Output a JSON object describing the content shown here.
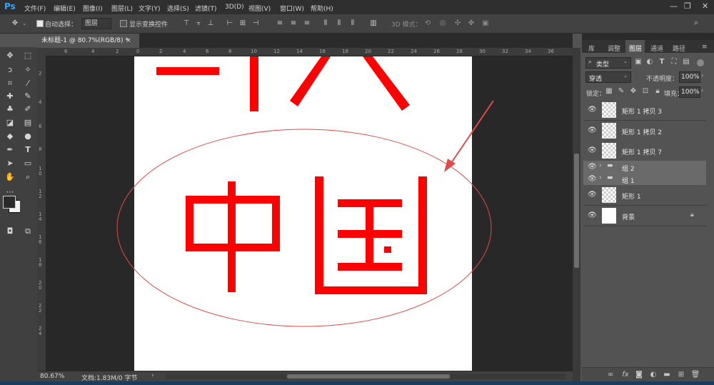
{
  "app": {
    "logo": "Ps"
  },
  "menu": [
    "文件(F)",
    "编辑(E)",
    "图像(I)",
    "图层(L)",
    "文字(Y)",
    "选择(S)",
    "滤镜(T)",
    "3D(D)",
    "视图(V)",
    "窗口(W)",
    "帮助(H)"
  ],
  "window_controls": {
    "minimize": "—",
    "restore": "❐",
    "close": "✕"
  },
  "options": {
    "auto_select_label": "自动选择：",
    "auto_select_value": "图层",
    "show_transform_label": "显示变换控件",
    "mode_3d_label": "3D 模式："
  },
  "document_tab": {
    "title": "未标题-1 @ 80.7%(RGB/8) *",
    "close": "×"
  },
  "ruler": {
    "h_labels": [
      "6",
      "4",
      "2",
      "0",
      "2",
      "4",
      "6",
      "8",
      "10",
      "12",
      "14",
      "16",
      "18",
      "20",
      "22",
      "24",
      "26",
      "28",
      "30",
      "32",
      "34",
      "36"
    ],
    "v_labels": [
      "2",
      "4",
      "6",
      "8",
      "1 0",
      "1 2",
      "1 4",
      "1 6",
      "1 8",
      "2 0",
      "2 2",
      "2 4"
    ]
  },
  "status": {
    "zoom": "80.67%",
    "doc": "文档:1.83M/0 字节"
  },
  "canvas": {
    "glyphs": "中国"
  },
  "panel": {
    "tabs": [
      "库",
      "调整",
      "图层",
      "通道",
      "路径"
    ],
    "active_tab": "图层",
    "filter_label": "类型",
    "blend_mode": "穿透",
    "opacity_label": "不透明度：",
    "opacity_value": "100%",
    "lock_label": "锁定：",
    "fill_label": "填充：",
    "fill_value": "100%",
    "layers": [
      {
        "name": "矩形 1 拷贝 3",
        "type": "shape"
      },
      {
        "name": "矩形 1 拷贝 2",
        "type": "shape"
      },
      {
        "name": "矩形 1 拷贝 7",
        "type": "shape"
      },
      {
        "name": "组 2",
        "type": "group"
      },
      {
        "name": "组 1",
        "type": "group"
      },
      {
        "name": "矩形 1",
        "type": "shape"
      },
      {
        "name": "背景",
        "type": "background"
      }
    ],
    "footer_icons": [
      "link-icon",
      "fx-icon",
      "mask-icon",
      "adjustment-icon",
      "folder-icon",
      "new-layer-icon",
      "trash-icon"
    ]
  },
  "colors": {
    "accent": "#31a8ff",
    "shape_red": "#ff0000",
    "ellipse_red": "#e14a4a"
  }
}
